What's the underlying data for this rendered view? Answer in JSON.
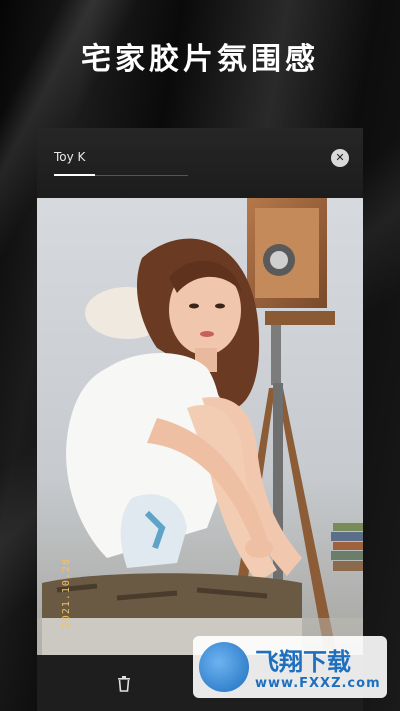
{
  "headline": "宅家胶片氛围感",
  "filter": {
    "name": "Toy K",
    "close_icon": "close-icon"
  },
  "photo": {
    "date_stamp": "2021.10.28"
  },
  "toolbar": {
    "delete_icon": "trash-icon"
  },
  "watermark": {
    "title": "飞翔下载",
    "url": "www.FXXZ.com"
  },
  "colors": {
    "background": "#0b0b0b",
    "panel": "#1e1e1e",
    "accent": "#1f6fbf",
    "stamp": "#f3c063"
  }
}
